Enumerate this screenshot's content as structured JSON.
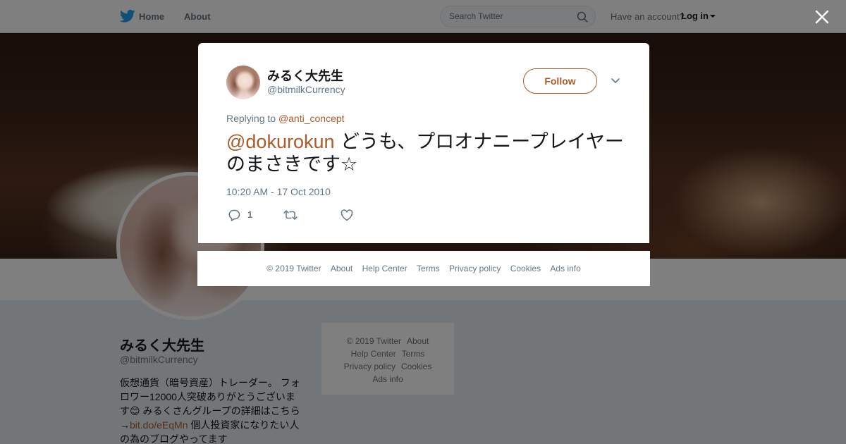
{
  "nav": {
    "home_label": "Home",
    "about_label": "About",
    "search_placeholder": "Search Twitter",
    "have_account": "Have an account?",
    "login_label": "Log in"
  },
  "profile": {
    "name": "みるく大先生",
    "handle": "@bitmilkCurrency",
    "bio_part1": "仮想通貨（暗号資産）トレーダー。 フォロワー12000人突破ありがとうございます😊 みるくさんグループの詳細はこちら→",
    "bio_link": "bit.do/eEqMn",
    "bio_part2": " 個人投資家になりたい人の為のブログやってます"
  },
  "side_footer": {
    "items": [
      "© 2019 Twitter",
      "About",
      "Help Center",
      "Terms",
      "Privacy policy",
      "Cookies",
      "Ads info"
    ]
  },
  "tweet": {
    "author_name": "みるく大先生",
    "author_handle": "@bitmilkCurrency",
    "follow_label": "Follow",
    "replying_prefix": "Replying to",
    "replying_to": "@anti_concept",
    "mention": "@dokurokun",
    "text": " どうも、プロオナニープレイヤーのまさきです☆",
    "timestamp": "10:20 AM - 17 Oct 2010",
    "reply_count": "1"
  },
  "modal_footer": {
    "items": [
      "© 2019 Twitter",
      "About",
      "Help Center",
      "Terms",
      "Privacy policy",
      "Cookies",
      "Ads info"
    ]
  },
  "colors": {
    "link": "#ab5b2a",
    "twitter_blue": "#1da1f2"
  },
  "icons": [
    "twitter-bird-icon",
    "search-icon",
    "caret-down-icon",
    "close-icon",
    "chevron-down-icon",
    "reply-icon",
    "retweet-icon",
    "heart-icon"
  ]
}
